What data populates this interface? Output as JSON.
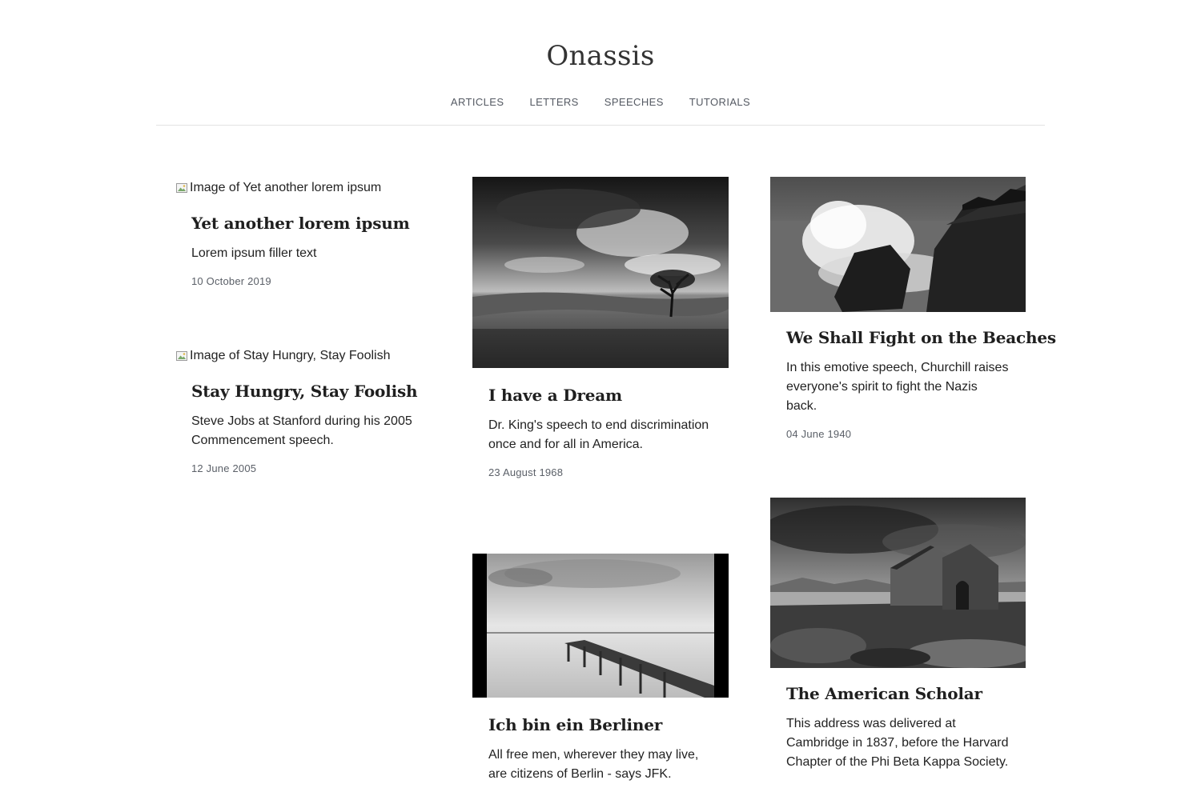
{
  "site": {
    "title": "Onassis"
  },
  "nav": {
    "items": [
      {
        "label": "ARTICLES"
      },
      {
        "label": "LETTERS"
      },
      {
        "label": "SPEECHES"
      },
      {
        "label": "TUTORIALS"
      }
    ]
  },
  "posts": [
    {
      "image_alt": "Image of Yet another lorem ipsum",
      "title": "Yet another lorem ipsum",
      "excerpt": "Lorem ipsum filler text",
      "date": "10 October 2019"
    },
    {
      "image_alt": "Image of Stay Hungry, Stay Foolish",
      "title": "Stay Hungry, Stay Foolish",
      "excerpt": "Steve Jobs at Stanford during his 2005 Commencement speech.",
      "date": "12 June 2005"
    },
    {
      "image_desc": "stormy-landscape-tree-photo",
      "title": "I have a Dream",
      "excerpt": "Dr. King's speech to end discrimination once and for all in America.",
      "date": "23 August 1968"
    },
    {
      "image_desc": "pier-lake-photo",
      "title": "Ich bin ein Berliner",
      "excerpt": "All free men, wherever they may live, are citizens of Berlin - says JFK."
    },
    {
      "image_desc": "waves-crashing-rocks-photo",
      "title": "We Shall Fight on the Beaches",
      "excerpt": "In this emotive speech, Churchill raises everyone's spirit to fight the Nazis back.",
      "date": "04 June 1940"
    },
    {
      "image_desc": "stone-church-lake-photo",
      "title": "The American Scholar",
      "excerpt": "This address was delivered at Cambridge in 1837, before the Harvard Chapter of the Phi Beta Kappa Society."
    }
  ]
}
